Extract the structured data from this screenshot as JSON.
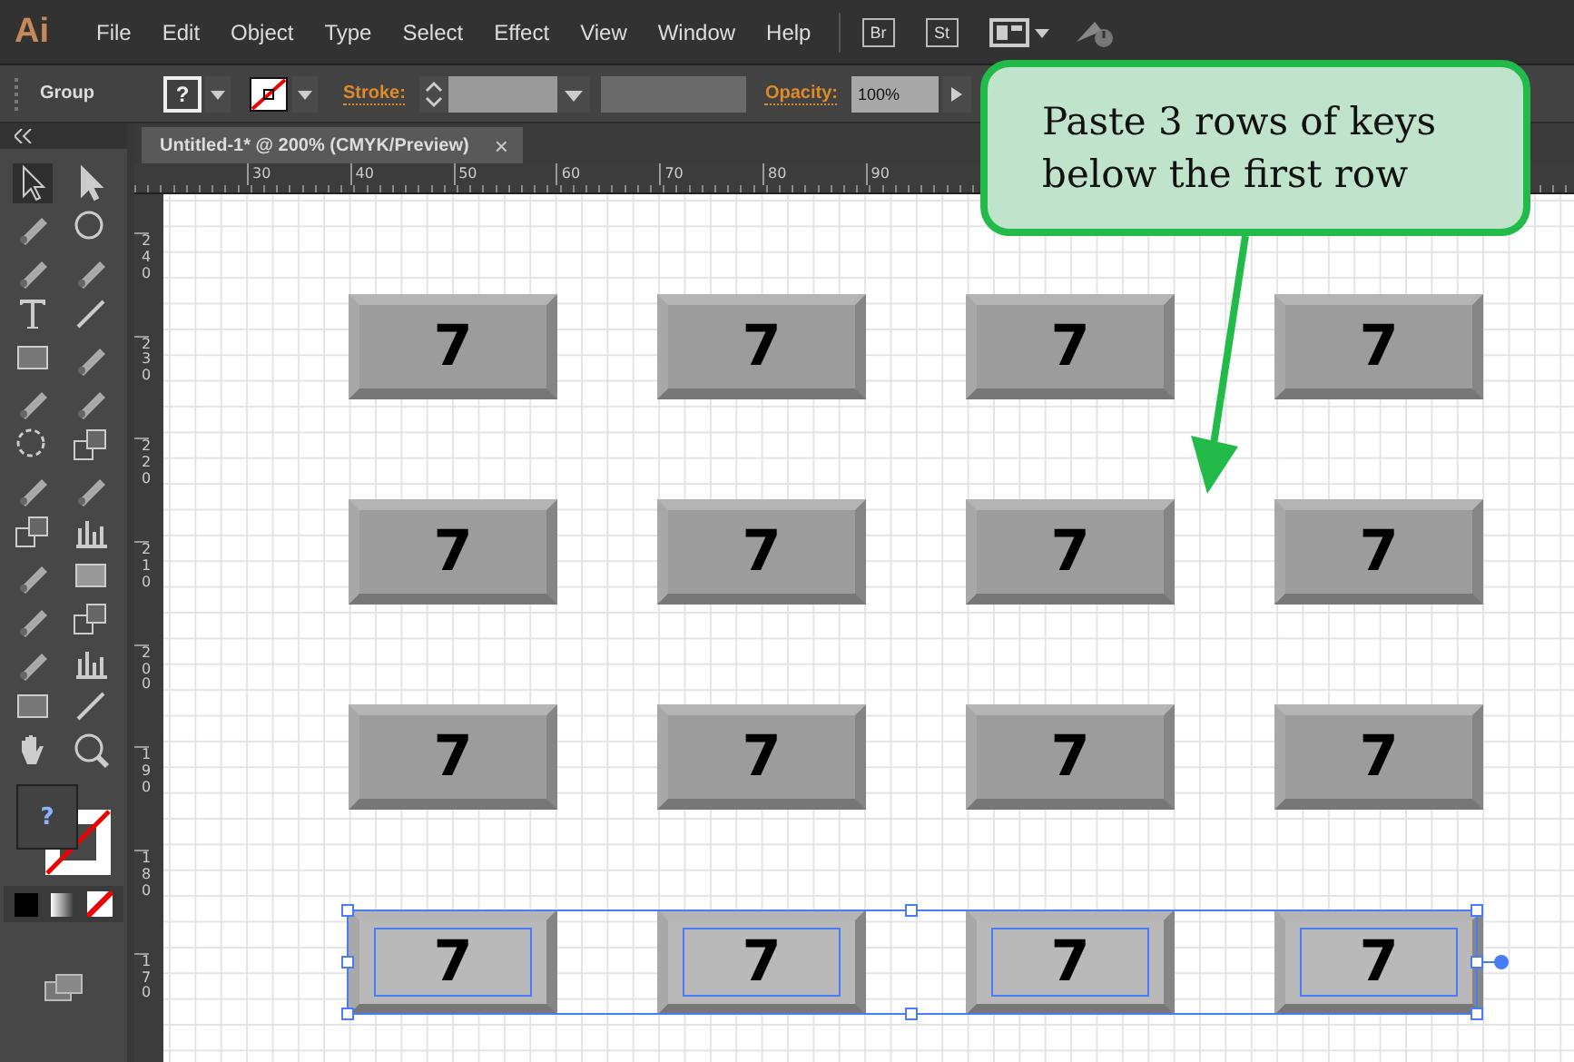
{
  "app_logo": "Ai",
  "menu": [
    "File",
    "Edit",
    "Object",
    "Type",
    "Select",
    "Effect",
    "View",
    "Window",
    "Help"
  ],
  "app_buttons": [
    "Br",
    "St"
  ],
  "control_bar": {
    "selection_label": "Group",
    "fill_swatch": "?",
    "stroke_label": "Stroke:",
    "opacity_label": "Opacity:",
    "opacity_value": "100%"
  },
  "document_tab": {
    "title": "Untitled-1* @ 200% (CMYK/Preview)",
    "close": "×",
    "selected": true
  },
  "ruler": {
    "horizontal": [
      "30",
      "40",
      "50",
      "60",
      "70",
      "80",
      "90"
    ],
    "vertical": [
      "240",
      "230",
      "220",
      "210",
      "200",
      "190",
      "180",
      "170"
    ]
  },
  "toolbar": {
    "fill_swatch": "?"
  },
  "key_rows": [
    {
      "selected": false,
      "keys": [
        "7",
        "7",
        "7",
        "7"
      ]
    },
    {
      "selected": false,
      "keys": [
        "7",
        "7",
        "7",
        "7"
      ]
    },
    {
      "selected": false,
      "keys": [
        "7",
        "7",
        "7",
        "7"
      ]
    },
    {
      "selected": true,
      "keys": [
        "7",
        "7",
        "7",
        "7"
      ]
    }
  ],
  "callout": {
    "text": "Paste 3 rows of keys below the first row"
  }
}
